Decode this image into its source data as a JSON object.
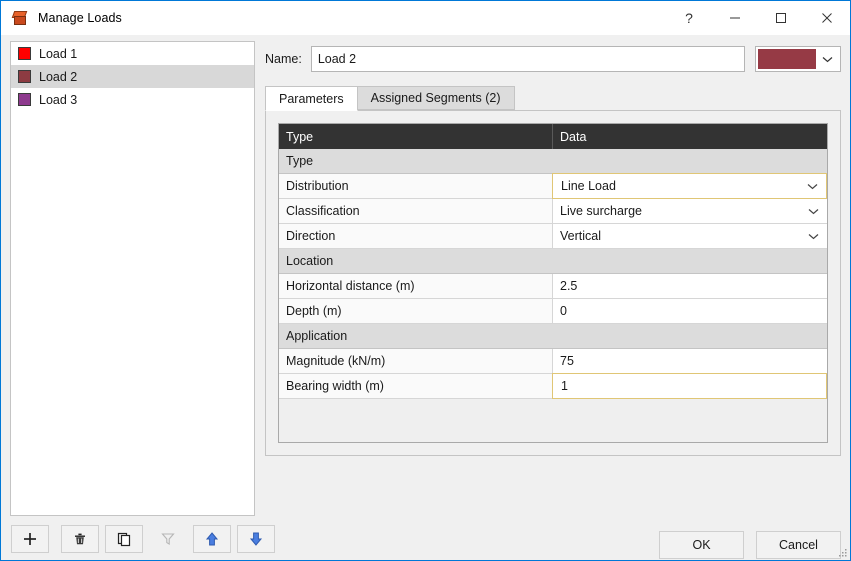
{
  "window": {
    "title": "Manage Loads",
    "icon": "cube-icon",
    "accent_border": "#0078d7",
    "controls": [
      {
        "name": "help-button",
        "glyph": "?",
        "label": "?"
      },
      {
        "name": "minimize-button",
        "glyph": "—",
        "label": "Minimize"
      },
      {
        "name": "maximize-button",
        "glyph": "□",
        "label": "Maximize"
      },
      {
        "name": "close-button",
        "glyph": "✕",
        "label": "Close"
      }
    ]
  },
  "load_list": {
    "items": [
      {
        "label": "Load 1",
        "color": "#ff0000",
        "selected": false
      },
      {
        "label": "Load 2",
        "color": "#8d3b42",
        "selected": true
      },
      {
        "label": "Load 3",
        "color": "#8e3a8e",
        "selected": false
      }
    ]
  },
  "list_toolbar": {
    "buttons": [
      {
        "name": "add-load-button",
        "icon": "plus-icon",
        "enabled": true
      },
      {
        "name": "delete-load-button",
        "icon": "trash-icon",
        "enabled": true
      },
      {
        "name": "duplicate-load-button",
        "icon": "copy-icon",
        "enabled": true
      },
      {
        "name": "filter-button",
        "icon": "funnel-icon",
        "enabled": false
      },
      {
        "name": "move-up-button",
        "icon": "arrow-up-icon",
        "enabled": true
      },
      {
        "name": "move-down-button",
        "icon": "arrow-down-icon",
        "enabled": true
      }
    ]
  },
  "name_row": {
    "label": "Name:",
    "value": "Load 2",
    "placeholder": "",
    "color_value": "#963a45",
    "color_caret_icon": "chevron-down-icon"
  },
  "tabs": [
    {
      "label": "Parameters",
      "active": true
    },
    {
      "label": "Assigned Segments (2)",
      "active": false
    }
  ],
  "grid": {
    "columns": [
      "Type",
      "Data"
    ],
    "sections": [
      {
        "group": "Type",
        "rows": [
          {
            "label": "Distribution",
            "value": "Line Load",
            "control": "dropdown",
            "focused": true
          },
          {
            "label": "Classification",
            "value": "Live surcharge",
            "control": "dropdown",
            "focused": false
          },
          {
            "label": "Direction",
            "value": "Vertical",
            "control": "dropdown",
            "focused": false
          }
        ]
      },
      {
        "group": "Location",
        "rows": [
          {
            "label": "Horizontal distance (m)",
            "value": "2.5",
            "control": "text",
            "focused": false
          },
          {
            "label": "Depth (m)",
            "value": "0",
            "control": "text",
            "focused": false
          }
        ]
      },
      {
        "group": "Application",
        "rows": [
          {
            "label": "Magnitude (kN/m)",
            "value": "75",
            "control": "text",
            "focused": false
          },
          {
            "label": "Bearing width (m)",
            "value": "1",
            "control": "text",
            "focused": true
          }
        ]
      }
    ]
  },
  "footer": {
    "ok_label": "OK",
    "cancel_label": "Cancel"
  }
}
